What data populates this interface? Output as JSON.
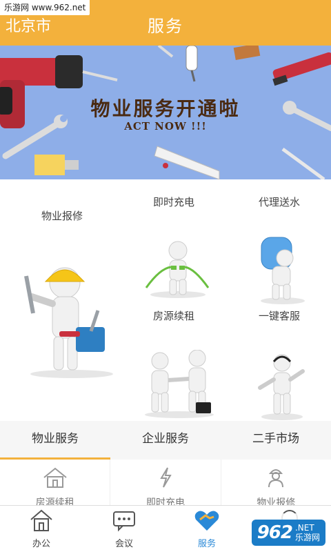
{
  "watermark": {
    "top_text": "乐游网 www.962.net",
    "badge_num": "962",
    "badge_net": ".NET",
    "badge_cn": "乐游网"
  },
  "header": {
    "city": "北京市",
    "title": "服务"
  },
  "banner": {
    "title": "物业服务开通啦",
    "subtitle": "ACT NOW !!!"
  },
  "grid": {
    "items": [
      {
        "label": "物业报修"
      },
      {
        "label": "即时充电"
      },
      {
        "label": "代理送水"
      },
      {
        "label": "房源续租"
      },
      {
        "label": "一键客服"
      }
    ]
  },
  "tabs": [
    {
      "label": "物业服务",
      "active": true
    },
    {
      "label": "企业服务"
    },
    {
      "label": "二手市场"
    }
  ],
  "subitems": [
    {
      "label": "房源续租",
      "icon": "house-icon"
    },
    {
      "label": "即时充电",
      "icon": "lightning-icon"
    },
    {
      "label": "物业报修",
      "icon": "worker-icon"
    }
  ],
  "nav": [
    {
      "label": "办公",
      "icon": "house-icon"
    },
    {
      "label": "会议",
      "icon": "chat-icon"
    },
    {
      "label": "服务",
      "icon": "handshake-icon",
      "active": true
    },
    {
      "label": "",
      "icon": "user-icon"
    }
  ],
  "colors": {
    "accent": "#f3b13c",
    "banner_bg": "#8eaee8",
    "nav_active": "#2a89d7"
  }
}
